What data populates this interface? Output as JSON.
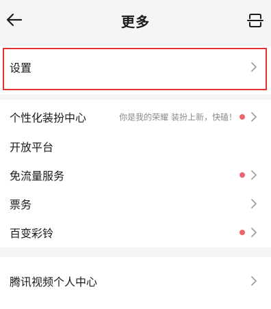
{
  "header": {
    "title": "更多",
    "back_icon": "arrow-left-icon",
    "scan_icon": "scan-icon"
  },
  "settings": {
    "label": "设置"
  },
  "menu": {
    "personalization": {
      "label": "个性化装扮中心",
      "subtitle": "你是我的荣耀 装扮上新，快磕！",
      "has_dot": true
    },
    "open_platform": {
      "label": "开放平台"
    },
    "free_data": {
      "label": "免流量服务",
      "has_dot": true
    },
    "tickets": {
      "label": "票务"
    },
    "ringtones": {
      "label": "百变彩铃",
      "has_dot": true
    }
  },
  "account": {
    "tencent_video": {
      "label": "腾讯视频个人中心"
    }
  },
  "colors": {
    "highlight_border": "#e53030",
    "badge_dot": "#f0636b",
    "background": "#f5f5f5",
    "card": "#ffffff"
  }
}
